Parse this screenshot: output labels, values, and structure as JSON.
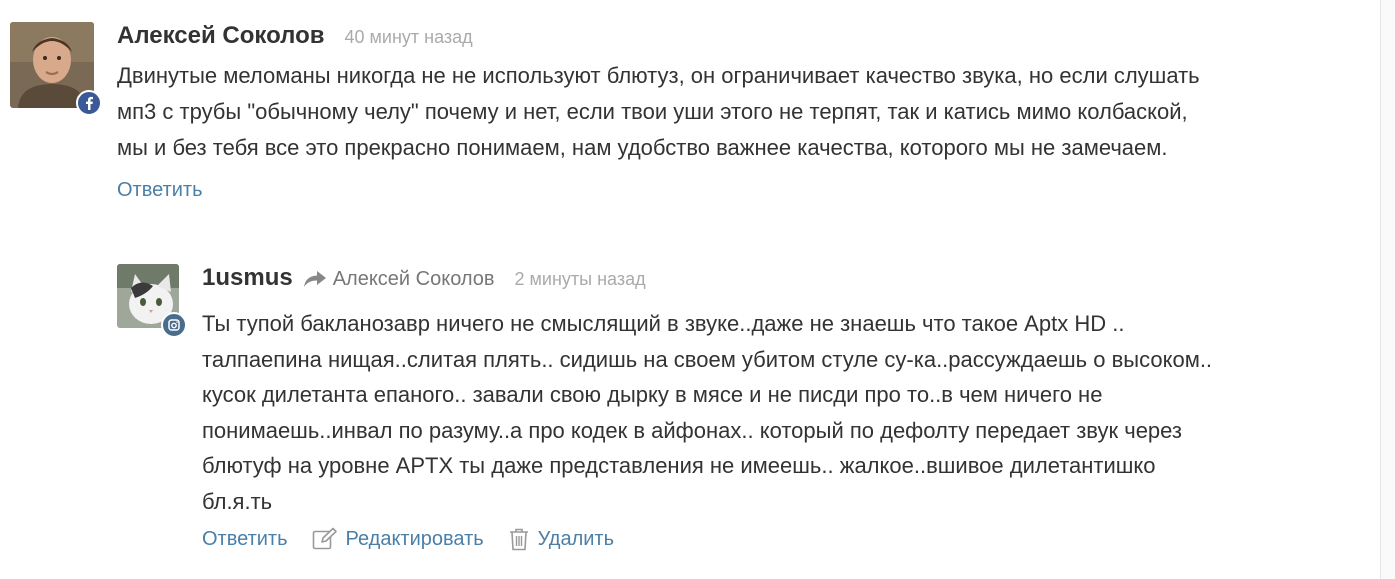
{
  "comments": [
    {
      "author": "Алексей Соколов",
      "time": "40 минут назад",
      "text": "Двинутые меломаны никогда не не используют блютуз, он ограничивает качество звука, но если слушать\nмп3 с трубы \"обычному челу\" почему и нет, если твои уши этого не терпят, так и катись мимо колбаской,\nмы и без тебя все это прекрасно понимаем, нам удобство важнее качества, которого мы не замечаем.",
      "actions": {
        "reply": "Ответить"
      },
      "social": "facebook-icon"
    },
    {
      "author": "1usmus",
      "reply_to": "Алексей Соколов",
      "time": "2 минуты назад",
      "text": "Ты тупой бакланозавр ничего не смыслящий в звуке..даже не знаешь что такое Aptx HD ..\nталпаепина нищая..слитая плять.. сидишь на своем убитом стуле су-ка..рассуждаешь о высоком..\nкусок дилетанта епаного.. завали свою дырку в мясе и не писди про то..в чем ничего не\nпонимаешь..инвал по разуму..а про кодек в айфонах.. который по дефолту передает звук через\nблютуф на уровне APTX ты даже представления не имеешь.. жалкое..вшивое дилетантишко\nбл.я.ть",
      "actions": {
        "reply": "Ответить",
        "edit": "Редактировать",
        "delete": "Удалить"
      },
      "social": "camera-icon"
    }
  ],
  "colors": {
    "link": "#4a7fa8",
    "meta": "#aaaaaa",
    "text": "#333333",
    "facebook": "#3b5998"
  }
}
